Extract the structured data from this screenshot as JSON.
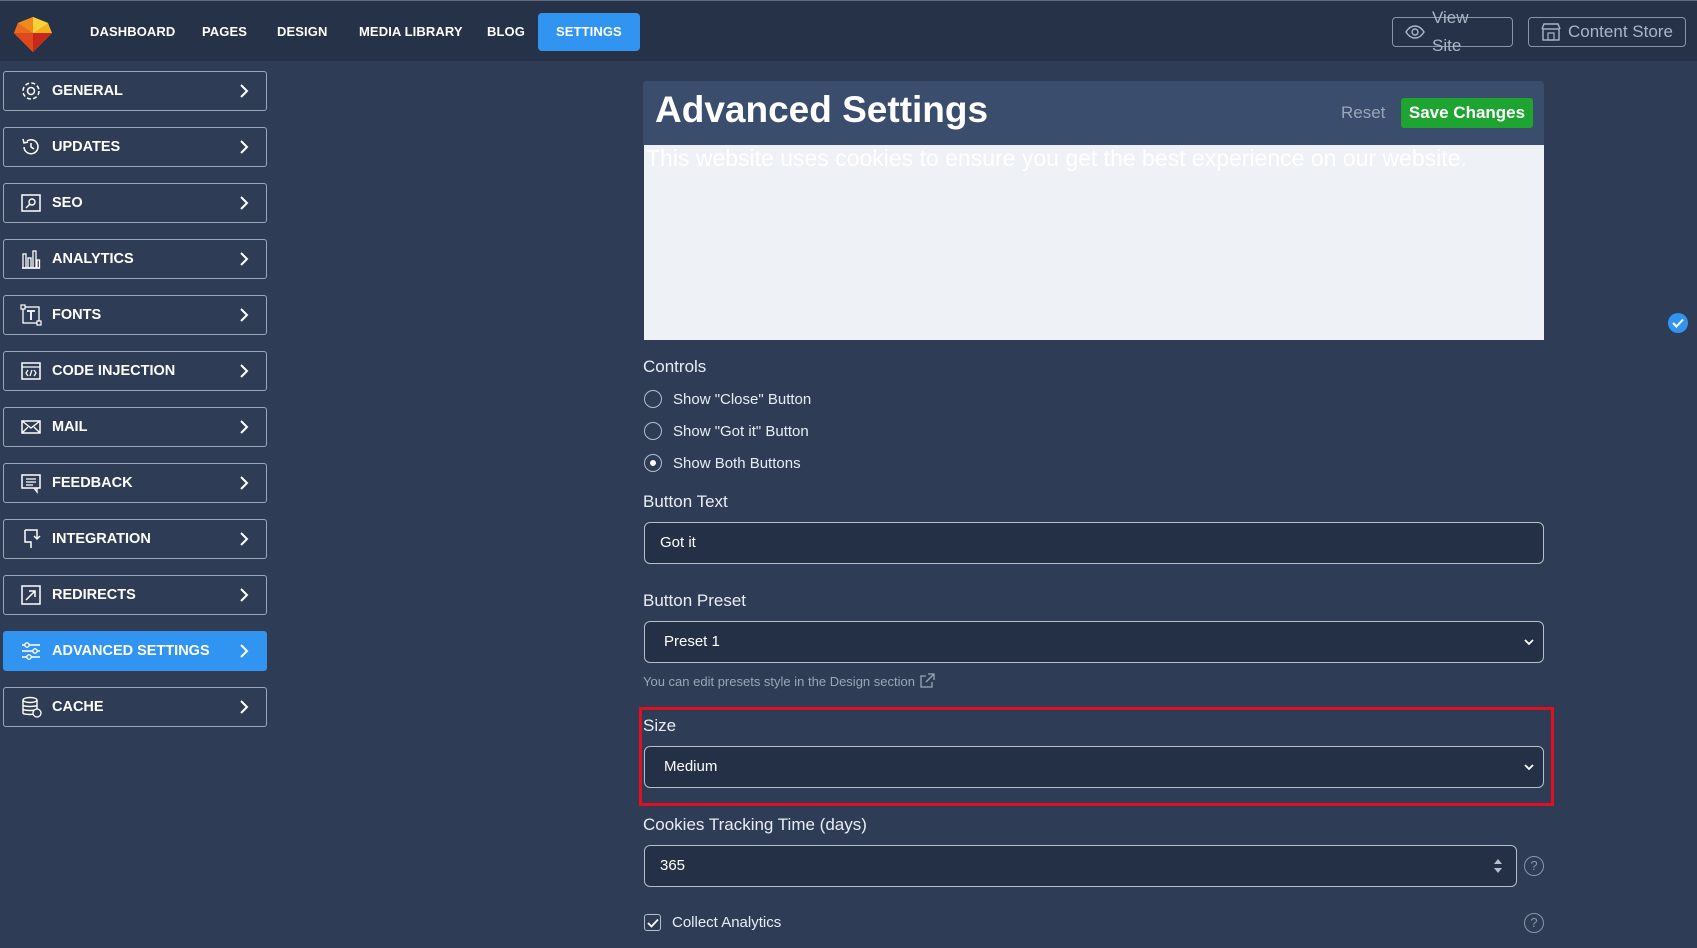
{
  "nav": {
    "items": [
      "DASHBOARD",
      "PAGES",
      "DESIGN",
      "MEDIA LIBRARY",
      "BLOG",
      "SETTINGS"
    ],
    "active": "SETTINGS",
    "view_site": "View Site",
    "content_store": "Content Store"
  },
  "sidebar": {
    "items": [
      {
        "label": "GENERAL",
        "icon": "gear-icon"
      },
      {
        "label": "UPDATES",
        "icon": "history-icon"
      },
      {
        "label": "SEO",
        "icon": "seo-icon"
      },
      {
        "label": "ANALYTICS",
        "icon": "bar-chart-icon"
      },
      {
        "label": "FONTS",
        "icon": "font-icon"
      },
      {
        "label": "CODE INJECTION",
        "icon": "code-icon"
      },
      {
        "label": "MAIL",
        "icon": "mail-icon"
      },
      {
        "label": "FEEDBACK",
        "icon": "feedback-icon"
      },
      {
        "label": "INTEGRATION",
        "icon": "integration-icon"
      },
      {
        "label": "REDIRECTS",
        "icon": "redirect-icon"
      },
      {
        "label": "ADVANCED SETTINGS",
        "icon": "sliders-icon"
      },
      {
        "label": "CACHE",
        "icon": "database-icon"
      }
    ],
    "active": "ADVANCED SETTINGS"
  },
  "panel": {
    "title": "Advanced Settings",
    "reset": "Reset",
    "save": "Save Changes",
    "preview_text": "This website uses cookies to ensure you get the best experience on our website."
  },
  "form": {
    "controls_label": "Controls",
    "controls_options": [
      "Show \"Close\" Button",
      "Show \"Got it\" Button",
      "Show Both Buttons"
    ],
    "controls_selected": "Show Both Buttons",
    "button_text_label": "Button Text",
    "button_text_value": "Got it",
    "button_preset_label": "Button Preset",
    "button_preset_value": "Preset 1",
    "preset_hint": "You can edit presets style in the Design section",
    "size_label": "Size",
    "size_value": "Medium",
    "tracking_label": "Cookies Tracking Time (days)",
    "tracking_value": "365",
    "collect_analytics_label": "Collect Analytics",
    "collect_analytics_checked": true,
    "help_glyph": "?"
  },
  "colors": {
    "accent": "#3194f0",
    "save": "#1ea531",
    "highlight": "#e01020",
    "background": "#2e3d55"
  }
}
